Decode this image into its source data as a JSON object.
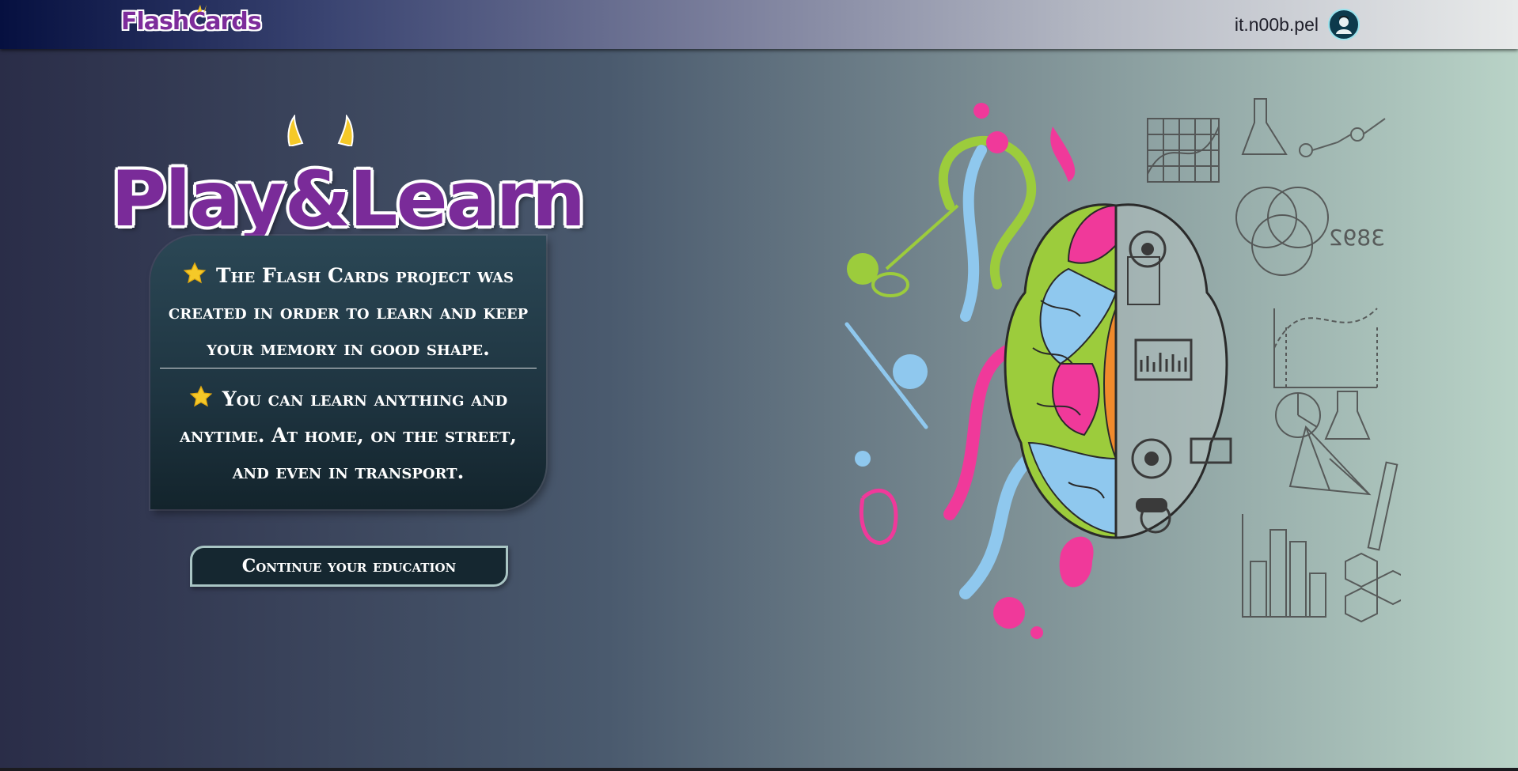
{
  "header": {
    "logo_text": "FlashCards",
    "username": "it.n00b.pel"
  },
  "hero": {
    "title": "Play&Learn"
  },
  "info_card": {
    "paragraph_1": "The Flash Cards project was created in order to learn and keep your memory in good shape.",
    "paragraph_2": "You can learn anything and anytime. At home, on the street, and even in transport."
  },
  "cta": {
    "label": "Continue your education"
  },
  "icons": {
    "user": "avatar-icon",
    "bullets": "star-icon",
    "illustration": "brain-illustration"
  },
  "colors": {
    "brand_purple": "#7a2b99",
    "star_yellow": "#f5c928",
    "card_bg": "#1e3440"
  }
}
